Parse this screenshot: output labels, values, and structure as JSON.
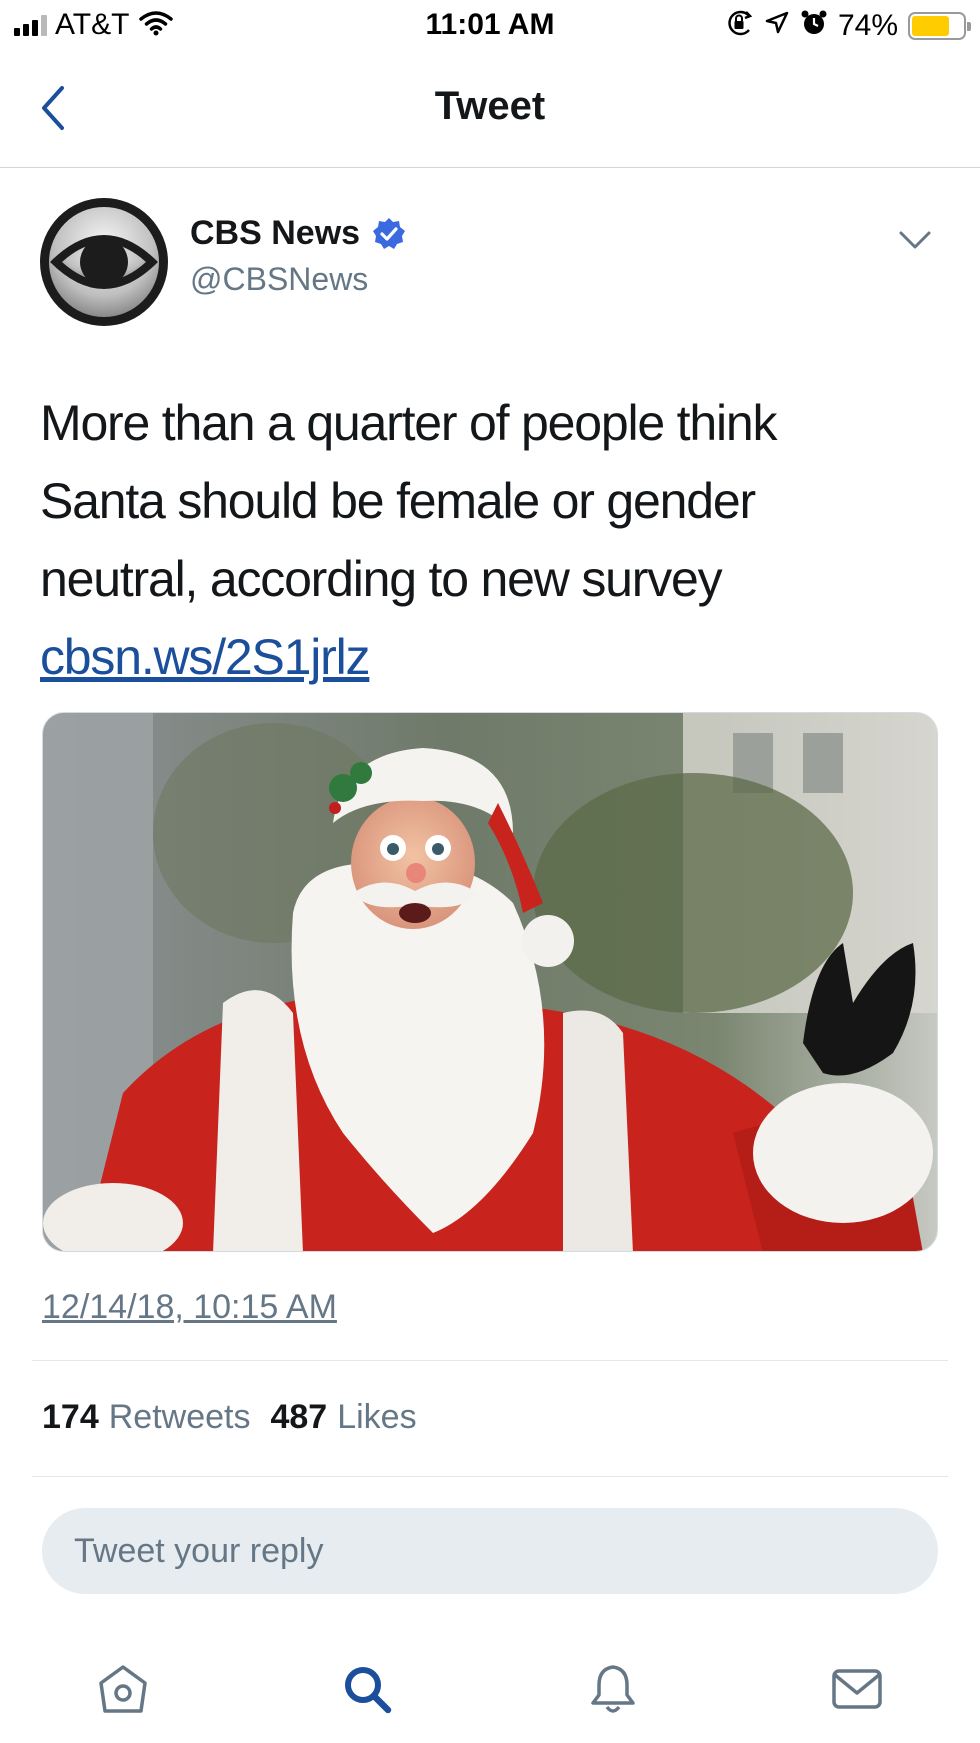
{
  "status_bar": {
    "carrier": "AT&T",
    "time": "11:01 AM",
    "battery_percent": "74%",
    "battery_level": 0.74,
    "battery_color": "#ffcc00",
    "icons": [
      "signal-icon",
      "wifi-icon",
      "orientation-lock-icon",
      "location-icon",
      "alarm-icon",
      "battery-icon"
    ]
  },
  "nav": {
    "title": "Tweet",
    "back_icon": "chevron-left-icon"
  },
  "tweet": {
    "author_name": "CBS News",
    "author_handle": "@CBSNews",
    "verified": true,
    "text_lines": [
      "More than a quarter of people think",
      "Santa should be female or gender",
      "neutral, according to new survey"
    ],
    "link": "cbsn.ws/2S1jrlz",
    "timestamp": "12/14/18, 10:15 AM",
    "retweets_count": "174",
    "retweets_label": "Retweets",
    "likes_count": "487",
    "likes_label": "Likes"
  },
  "reply": {
    "placeholder": "Tweet your reply"
  },
  "tab_bar": {
    "items": [
      "home-icon",
      "search-icon",
      "notifications-icon",
      "messages-icon"
    ],
    "active": "search-icon"
  },
  "colors": {
    "accent": "#1da1f2",
    "link": "#1b4f9c",
    "secondary_text": "#657786"
  }
}
